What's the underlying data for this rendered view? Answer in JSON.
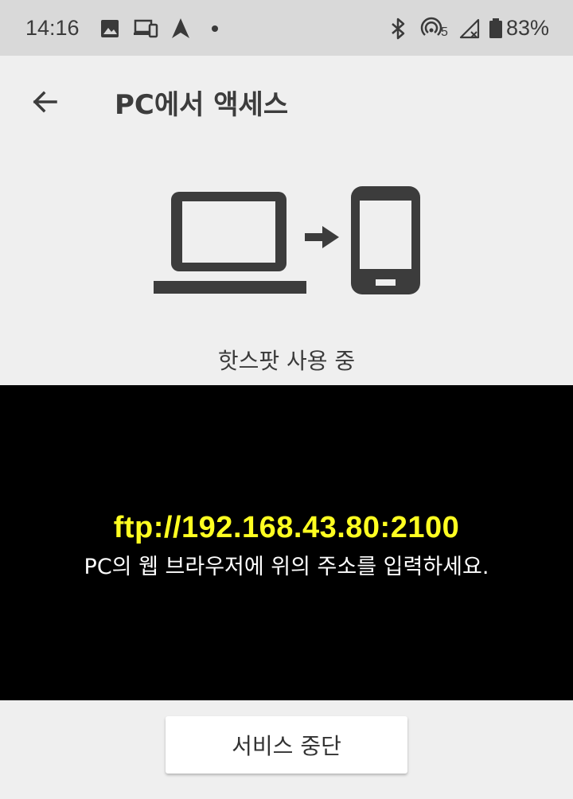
{
  "status_bar": {
    "time": "14:16",
    "battery_percent": "83%",
    "left_icons": [
      "image-icon",
      "devices-icon",
      "navigation-icon",
      "dot-icon"
    ],
    "right_icons": [
      "bluetooth-icon",
      "wifi-hotspot-icon",
      "cellular-signal-icon",
      "battery-icon"
    ],
    "hotspot_clients": "5"
  },
  "app_bar": {
    "title": "PC에서 액세스",
    "back_icon": "arrow-back-icon"
  },
  "illustration": {
    "icons": [
      "laptop-icon",
      "arrow-right-icon",
      "phone-icon"
    ]
  },
  "connection_status": "핫스팟 사용 중",
  "address_panel": {
    "address": "ftp://192.168.43.80:2100",
    "instruction": "PC의 웹 브라우저에 위의 주소를 입력하세요."
  },
  "footer": {
    "stop_button_label": "서비스 중단"
  },
  "colors": {
    "status_bar_bg": "#d9d9d9",
    "page_bg": "#efefef",
    "panel_bg": "#000000",
    "address_color": "#ffff21",
    "icon_color": "#3c3c3c"
  }
}
